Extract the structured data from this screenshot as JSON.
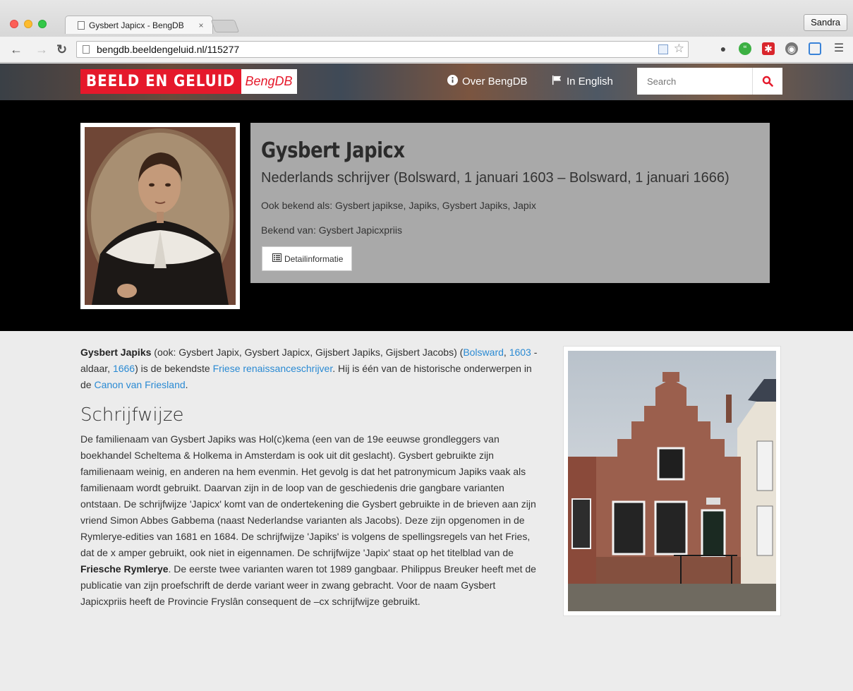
{
  "browser": {
    "tab_title": "Gysbert Japicx - BengDB",
    "tab_close": "×",
    "profile": "Sandra",
    "url": "bengdb.beeldengeluid.nl/115277"
  },
  "header": {
    "logo_main": "BEELD EN GELUID",
    "logo_sub": "BengDB",
    "about_label": "Over BengDB",
    "english_label": "In English",
    "search_placeholder": "Search"
  },
  "person": {
    "name": "Gysbert Japicx",
    "description": "Nederlands schrijver (Bolsward, 1 januari 1603 – Bolsward, 1 januari 1666)",
    "aka": "Ook bekend als: Gysbert japikse, Japiks, Gysbert Japiks, Japix",
    "known_for": "Bekend van: Gysbert Japicxpriis",
    "detail_button": "Detailinformatie"
  },
  "article": {
    "intro": {
      "name_bold": "Gysbert Japiks",
      "t1": " (ook: Gysbert Japix, Gysbert Japicx, Gijsbert Japiks, Gijsbert Jacobs) (",
      "link_bolsward": "Bolsward",
      "t2": ", ",
      "link_1603": "1603",
      "t3": " - aldaar, ",
      "link_1666": "1666",
      "t4": ") is de bekendste ",
      "link_friese": "Friese renaissanceschrijver",
      "t5": ". Hij is één van de historische onderwerpen in de ",
      "link_canon": "Canon van Friesland",
      "t6": "."
    },
    "section_title": "Schrijfwijze",
    "body": {
      "p1": "De familienaam van Gysbert Japiks was Hol(c)kema (een van de 19e eeuwse grondleggers van boekhandel Scheltema & Holkema in Amsterdam is ook uit dit geslacht). Gysbert gebruikte zijn familienaam weinig, en anderen na hem evenmin. Het gevolg is dat het patronymicum Japiks vaak als familienaam wordt gebruikt. Daarvan zijn in de loop van de geschiedenis drie gangbare varianten ontstaan. De schrijfwijze 'Japicx' komt van de ondertekening die Gysbert gebruikte in de brieven aan zijn vriend Simon Abbes Gabbema (naast Nederlandse varianten als Jacobs). Deze zijn opgenomen in de Rymlerye-edities van 1681 en 1684. De schrijfwijze 'Japiks' is volgens de spellingsregels van het Fries, dat de x amper gebruikt, ook niet in eigennamen. De schrijfwijze 'Japix' staat op het titelblad van de ",
      "bold": "Friesche Rymlerye",
      "p2": ". De eerste twee varianten waren tot 1989 gangbaar. Philippus Breuker heeft met de publicatie van zijn proefschrift de derde variant weer in zwang gebracht. Voor de naam Gysbert Japicxpriis heeft de Provincie Fryslân consequent de –cx schrijfwijze gebruikt."
    }
  },
  "colors": {
    "brand_red": "#e5192b",
    "link": "#2a8ad3",
    "hero_bg": "#000000",
    "infobox_bg": "#a9a9a9"
  }
}
